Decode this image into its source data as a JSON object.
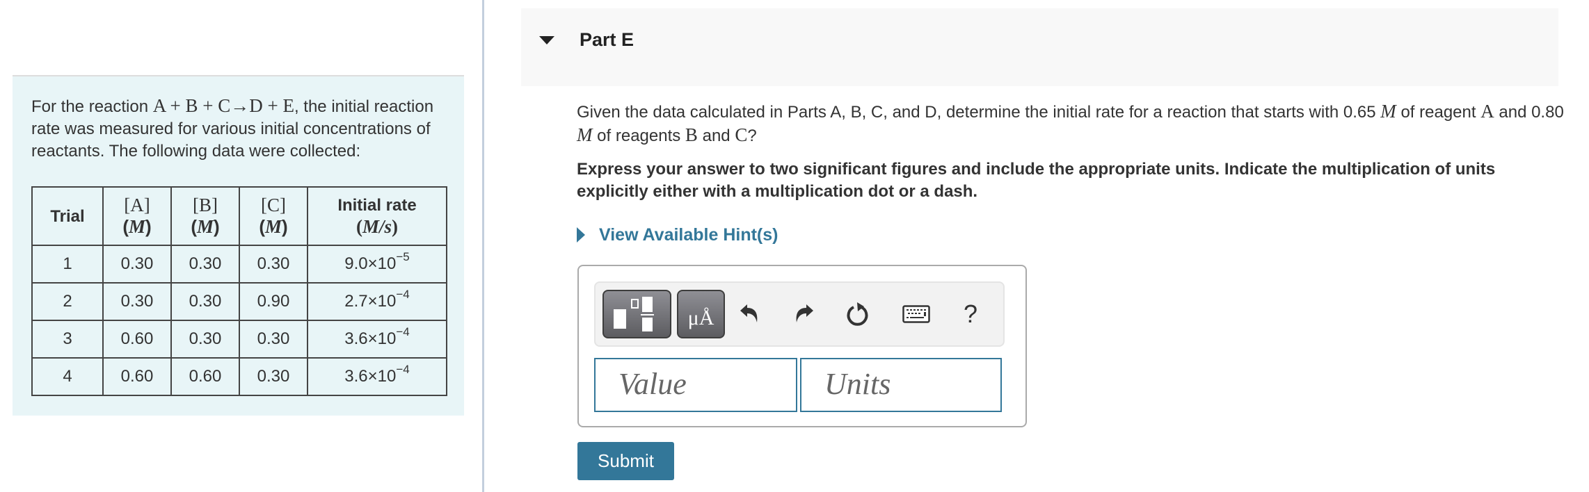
{
  "problem": {
    "intro_prefix": "For the reaction ",
    "reaction": "A + B + C→D + E",
    "intro_suffix": ", the initial reaction rate was measured for various initial concentrations of reactants. The following data were collected:",
    "table": {
      "headers": [
        {
          "top": "Trial",
          "bottom": ""
        },
        {
          "top": "[A]",
          "bottom": "M"
        },
        {
          "top": "[B]",
          "bottom": "M"
        },
        {
          "top": "[C]",
          "bottom": "M"
        },
        {
          "top": "Initial rate",
          "bottom": "M/s"
        }
      ],
      "rows": [
        {
          "trial": "1",
          "a": "0.30",
          "b": "0.30",
          "c": "0.30",
          "rate_mantissa": "9.0×10",
          "rate_exp": "−5"
        },
        {
          "trial": "2",
          "a": "0.30",
          "b": "0.30",
          "c": "0.90",
          "rate_mantissa": "2.7×10",
          "rate_exp": "−4"
        },
        {
          "trial": "3",
          "a": "0.60",
          "b": "0.30",
          "c": "0.30",
          "rate_mantissa": "3.6×10",
          "rate_exp": "−4"
        },
        {
          "trial": "4",
          "a": "0.60",
          "b": "0.60",
          "c": "0.30",
          "rate_mantissa": "3.6×10",
          "rate_exp": "−4"
        }
      ]
    }
  },
  "part": {
    "title": "Part E",
    "expanded": true,
    "question": {
      "t1": "Given the data calculated in Parts A, B, C, and D, determine the initial rate for a reaction that starts with 0.65 ",
      "m1": "M",
      "t2": " of reagent ",
      "r1": "A",
      "t3": " and 0.80 ",
      "m2": "M",
      "t4": " of reagents ",
      "r2": "B",
      "t5": " and ",
      "r3": "C",
      "t6": "?"
    },
    "instruction": "Express your answer to two significant figures and include the appropriate units. Indicate the multiplication of units explicitly either with a multiplication dot or a dash.",
    "hint_label": "View Available Hint(s)",
    "toolbar": {
      "templates_icon": "templates-icon",
      "units_label": "μÅ",
      "undo_icon": "undo-icon",
      "redo_icon": "redo-icon",
      "reset_icon": "reset-icon",
      "keyboard_icon": "keyboard-icon",
      "help_label": "?"
    },
    "inputs": {
      "value_placeholder": "Value",
      "value": "",
      "units_placeholder": "Units",
      "units": ""
    },
    "submit_label": "Submit"
  },
  "colors": {
    "accent": "#337799",
    "panel_bg": "#e8f5f7",
    "header_bg": "#f8f8f8",
    "divider": "#c3cfdd"
  }
}
